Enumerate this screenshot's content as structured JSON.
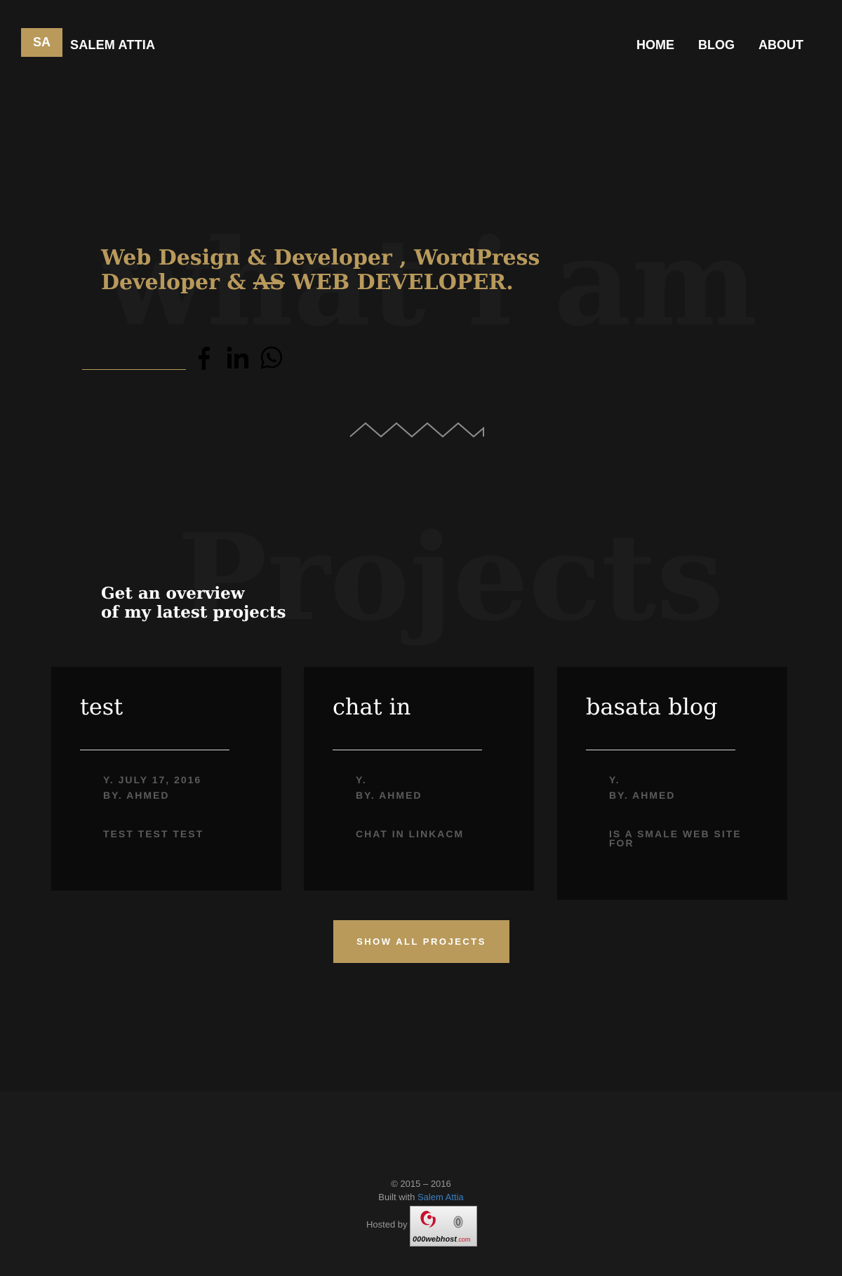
{
  "header": {
    "logo_initials": "SA",
    "brand": "SALEM ATTIA",
    "nav": [
      {
        "label": "HOME"
      },
      {
        "label": "BLOG"
      },
      {
        "label": "ABOUT"
      }
    ]
  },
  "hero": {
    "background_word": "what i am",
    "title_line1": "Web Design & Developer , WordPress",
    "title_line2_start": "Developer & ",
    "title_strike": "AS",
    "title_line2_end": " WEB DEVELOPER.",
    "social_icons": [
      "facebook-icon",
      "linkedin-icon",
      "whatsapp-icon"
    ]
  },
  "projects": {
    "background_word": "Projects",
    "intro_line1": "Get an overview",
    "intro_line2": "of my latest projects",
    "cards": [
      {
        "title": "test",
        "meta1": "Y. JULY 17, 2016",
        "meta2": "BY. AHMED",
        "description": "TEST TEST TEST"
      },
      {
        "title": "chat in",
        "meta1": "Y.",
        "meta2": "BY. AHMED",
        "description": "CHAT IN LINKACM"
      },
      {
        "title": "basata blog",
        "meta1": "Y.",
        "meta2": "BY. AHMED",
        "description": "IS A SMALE WEB SITE FOR"
      }
    ],
    "show_all_label": "SHOW ALL PROJECTS"
  },
  "footer": {
    "copyright": "© 2015 – 2016",
    "built_prefix": "Built with ",
    "built_link": "Salem Attia",
    "hosted_label": "Hosted by",
    "host_badge": "000webhost",
    "host_badge_suffix": ".com"
  },
  "colors": {
    "background": "#161617",
    "accent": "#b99a5b",
    "card": "#0b0b0b",
    "footer": "#1a1a1a",
    "link": "#3a7fc2"
  }
}
